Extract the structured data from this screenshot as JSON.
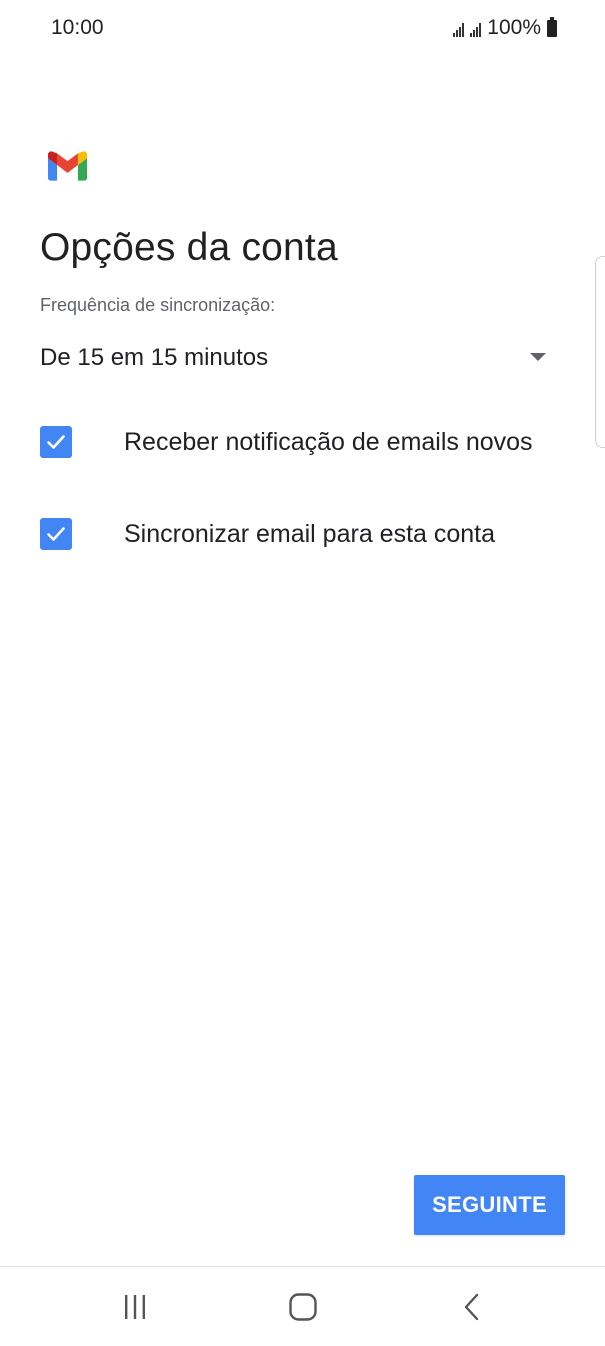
{
  "status_bar": {
    "time": "10:00",
    "battery_text": "100%",
    "icons": [
      "signal-icon",
      "signal-icon",
      "battery-icon"
    ]
  },
  "app": {
    "logo": "gmail-logo",
    "brand_colors": {
      "blue": "#4285f4",
      "red": "#ea4335",
      "yellow": "#fbbc04",
      "green": "#34a853"
    }
  },
  "page": {
    "title": "Opções da conta",
    "sync_frequency": {
      "label": "Frequência de sincronização:",
      "selected_value": "De 15 em 15 minutos"
    },
    "options": [
      {
        "label": "Receber notificação de emails novos",
        "checked": true
      },
      {
        "label": "Sincronizar email para esta conta",
        "checked": true
      }
    ],
    "next_button_label": "SEGUINTE"
  },
  "navigation": {
    "buttons": [
      "recent-apps-icon",
      "home-icon",
      "back-icon"
    ]
  },
  "colors": {
    "accent": "#4285f4",
    "text_primary": "#202124",
    "text_secondary": "#5f6368"
  }
}
